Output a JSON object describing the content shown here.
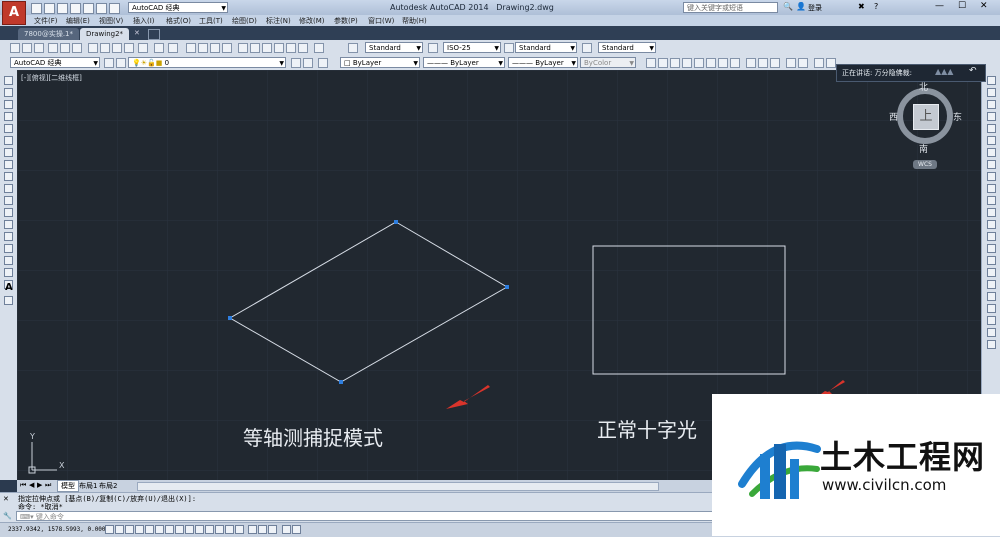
{
  "titlebar": {
    "app_icon_letter": "A",
    "workspace": "AutoCAD 经典",
    "app_name": "Autodesk AutoCAD 2014",
    "document": "Drawing2.dwg",
    "search_placeholder": "键入关键字或短语",
    "login": "登录"
  },
  "menu": [
    "文件(F)",
    "编辑(E)",
    "视图(V)",
    "插入(I)",
    "格式(O)",
    "工具(T)",
    "绘图(D)",
    "标注(N)",
    "修改(M)",
    "参数(P)",
    "窗口(W)",
    "帮助(H)"
  ],
  "doc_tabs": [
    "7800@实操.1*",
    "Drawing2*"
  ],
  "toolbar1": {
    "text_style": "Standard",
    "dim_style": "ISO-25",
    "table_style": "Standard",
    "mleader_style": "Standard"
  },
  "toolbar2": {
    "workspace": "AutoCAD 经典",
    "layer": "0",
    "color": "ByLayer",
    "linetype": "ByLayer",
    "lineweight": "ByLayer",
    "plotstyle": "ByColor"
  },
  "tooltip": {
    "text": "正在讲话: 万分隐佛裁:"
  },
  "viewport_label": "[-][俯视][二维线框]",
  "viewcube": {
    "north": "北",
    "south": "南",
    "east": "东",
    "west": "西",
    "top": "上",
    "wcs": "WCS"
  },
  "ucs": {
    "x": "X",
    "y": "Y"
  },
  "drawing": {
    "left_caption": "等轴测捕捉模式",
    "right_caption": "正常十字光",
    "line_color": "#d7dde6",
    "grip_color": "#2f7fe0",
    "arrow_color": "#d9342b"
  },
  "layout_tabs": [
    "模型",
    "布局1",
    "布局2"
  ],
  "command": {
    "history1": "指定拉伸点或 [基点(B)/复制(C)/放弃(U)/退出(X)]:",
    "history2": "命令: *取消*",
    "prompt": "键入命令"
  },
  "status": {
    "coords": "2337.9342,  1578.5993,  0.0000"
  },
  "watermark": {
    "name": "土木工程网",
    "url": "www.civilcn.com"
  },
  "colors": {
    "canvas": "#212830",
    "ui": "#d7dfea",
    "accent": "#c0392b"
  }
}
